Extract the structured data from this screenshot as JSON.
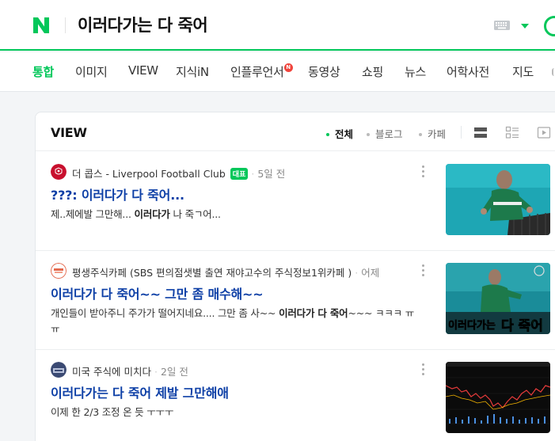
{
  "header": {
    "logo_letter": "N",
    "query": "이러다가는 다 죽어"
  },
  "tabs": [
    {
      "label": "통합",
      "active": true
    },
    {
      "label": "이미지"
    },
    {
      "label": "VIEW"
    },
    {
      "label": "지식iN"
    },
    {
      "label": "인플루언서",
      "new_badge": "N"
    },
    {
      "label": "동영상"
    },
    {
      "label": "쇼핑"
    },
    {
      "label": "뉴스"
    },
    {
      "label": "어학사전"
    },
    {
      "label": "지도"
    }
  ],
  "view": {
    "title": "VIEW",
    "filters": [
      "전체",
      "블로그",
      "카페"
    ],
    "items": [
      {
        "source": "더 콥스 - Liverpool Football Club",
        "badge": "대표",
        "time": "5일 전",
        "title": "???: 이러다가 다 죽어...",
        "desc_parts": [
          "제..제에발 그만해... ",
          "이러다가",
          " 나 죽ㄱ어..."
        ]
      },
      {
        "source": "평생주식카페 (SBS 편의점샛별 출연 재야고수의 주식정보1위카페 )",
        "time": "어제",
        "title": "이러다가 다 죽어~~ 그만 좀 매수해~~",
        "desc_parts": [
          "개인들이 받아주니 주가가 떨어지네요.... 그만 좀 사~~ ",
          "이러다가 다 죽어",
          "~~~ ㅋㅋㅋ ㅠㅠ"
        ],
        "thumb_caption_a": "이러다가는",
        "thumb_caption_b": "다 죽어"
      },
      {
        "source": "미국 주식에 미치다",
        "time": "2일 전",
        "title": "이러다가는 다 죽어 제발 그만해애",
        "desc_parts": [
          "이제 한 2/3 조정 온 듯 ㅜㅜㅜ"
        ]
      }
    ]
  },
  "colors": {
    "brand_green": "#03c75a",
    "title_blue": "#0d3fa6",
    "new_badge_red": "#f0443c"
  }
}
